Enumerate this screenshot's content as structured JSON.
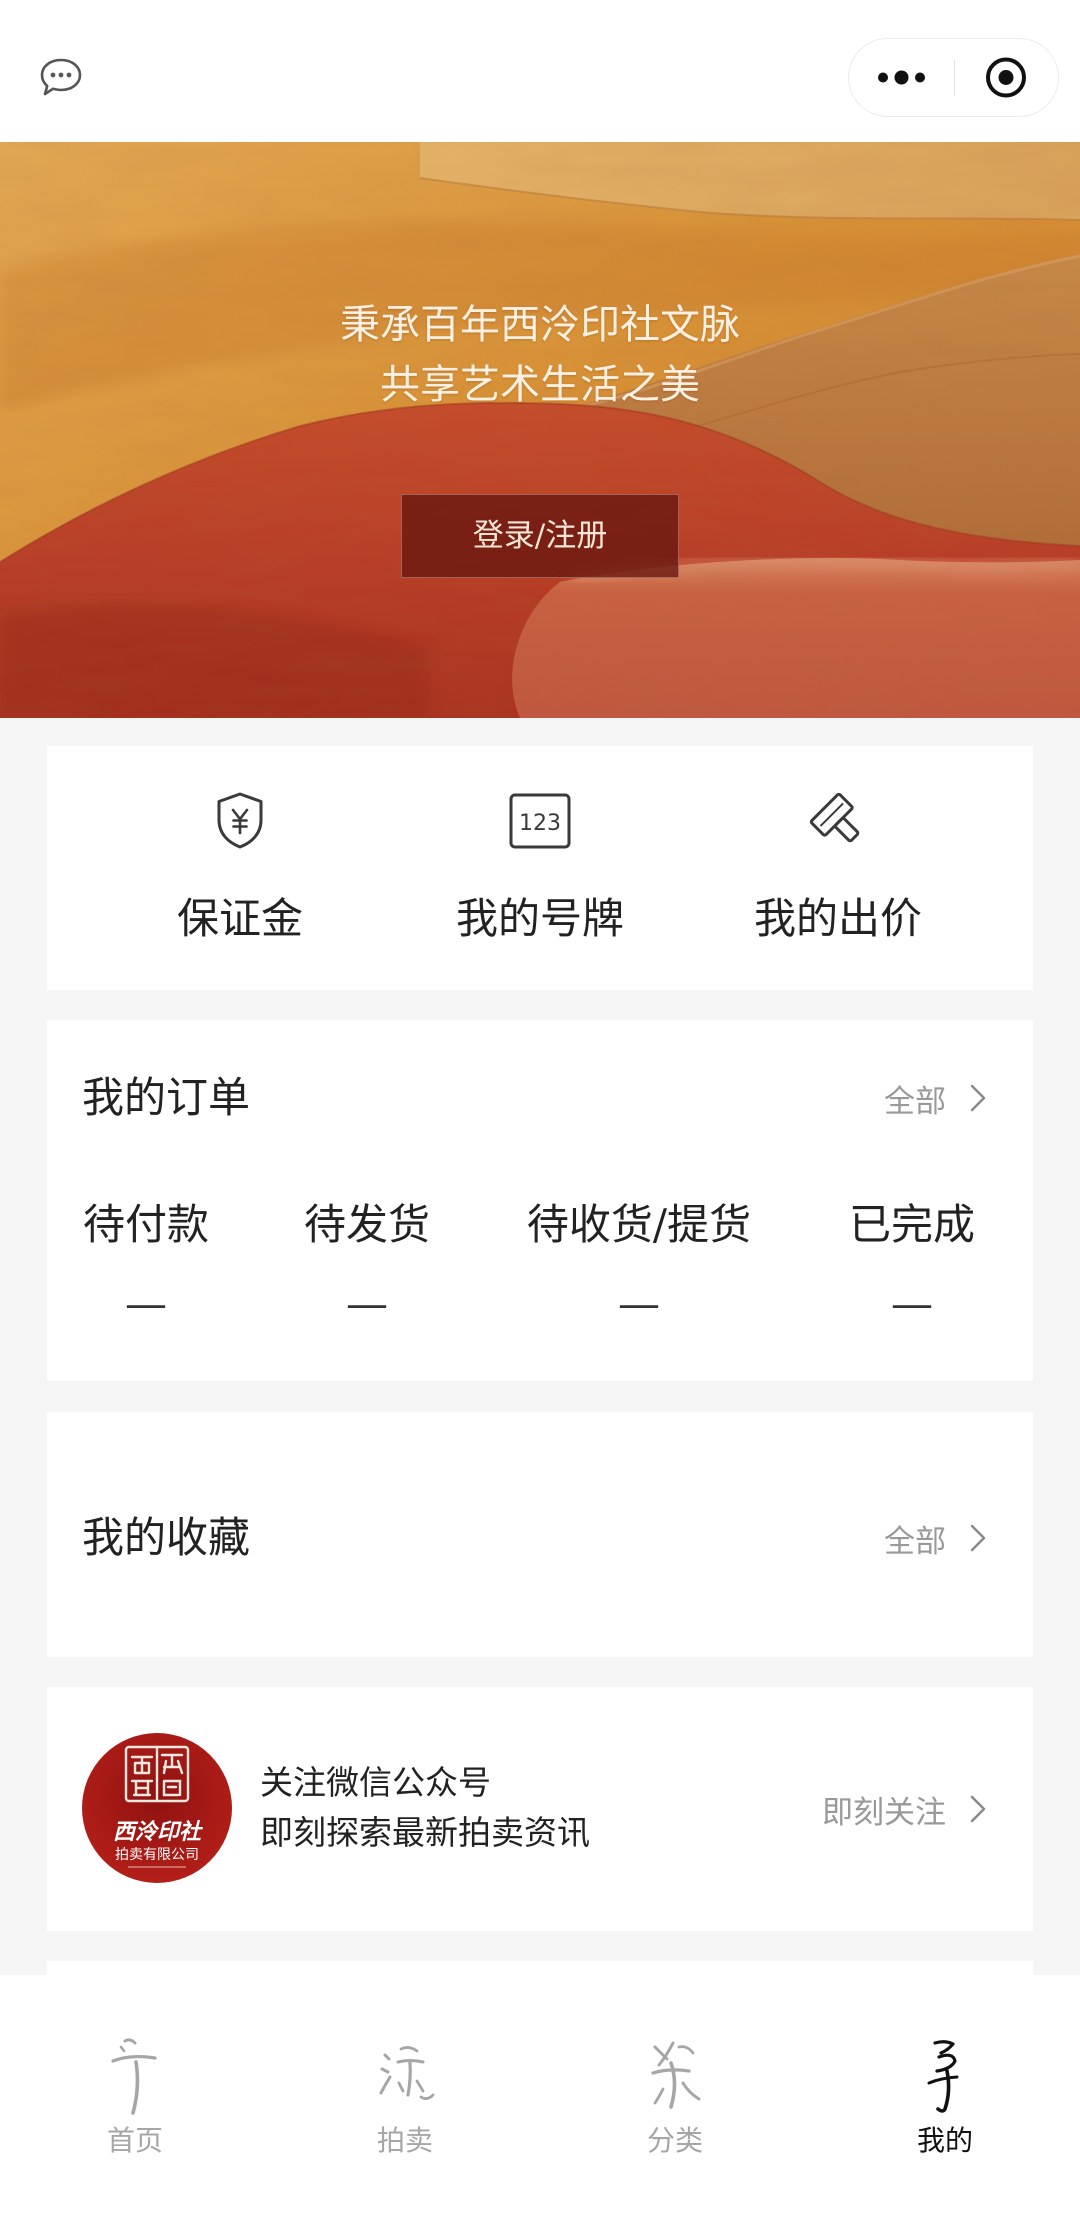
{
  "topbar": {
    "chat_icon": "chat-bubble-icon",
    "menu_icon": "more-dots-icon",
    "close_icon": "target-circle-icon"
  },
  "banner": {
    "line1": "秉承百年西泠印社文脉",
    "line2": "共享艺术生活之美",
    "login_label": "登录/注册"
  },
  "quick_actions": [
    {
      "label": "保证金",
      "icon": "shield-yen-icon"
    },
    {
      "label": "我的号牌",
      "icon": "number-plate-icon",
      "icon_text": "123"
    },
    {
      "label": "我的出价",
      "icon": "gavel-icon"
    }
  ],
  "orders": {
    "title": "我的订单",
    "all_label": "全部",
    "statuses": [
      {
        "label": "待付款",
        "count": "—"
      },
      {
        "label": "待发货",
        "count": "—"
      },
      {
        "label": "待收货/提货",
        "count": "—"
      },
      {
        "label": "已完成",
        "count": "—"
      }
    ]
  },
  "favorites": {
    "title": "我的收藏",
    "all_label": "全部"
  },
  "follow": {
    "line1": "关注微信公众号",
    "line2": "即刻探索最新拍卖资讯",
    "action_label": "即刻关注",
    "logo": {
      "name": "西泠印社",
      "subtitle": "拍卖有限公司"
    }
  },
  "tabbar": {
    "tabs": [
      {
        "label": "首页",
        "icon": "home-calligraphy-icon",
        "active": false
      },
      {
        "label": "拍卖",
        "icon": "auction-calligraphy-icon",
        "active": false
      },
      {
        "label": "分类",
        "icon": "category-calligraphy-icon",
        "active": false
      },
      {
        "label": "我的",
        "icon": "mine-calligraphy-icon",
        "active": true
      }
    ]
  },
  "colors": {
    "page_bg": "#f5f5f5",
    "text_primary": "#222222",
    "text_secondary": "#999999",
    "login_button": "rgba(104, 22, 16, 0.78)",
    "tab_active": "#111111",
    "tab_inactive": "#a6a6a6",
    "logo_red": "#a8181a"
  }
}
